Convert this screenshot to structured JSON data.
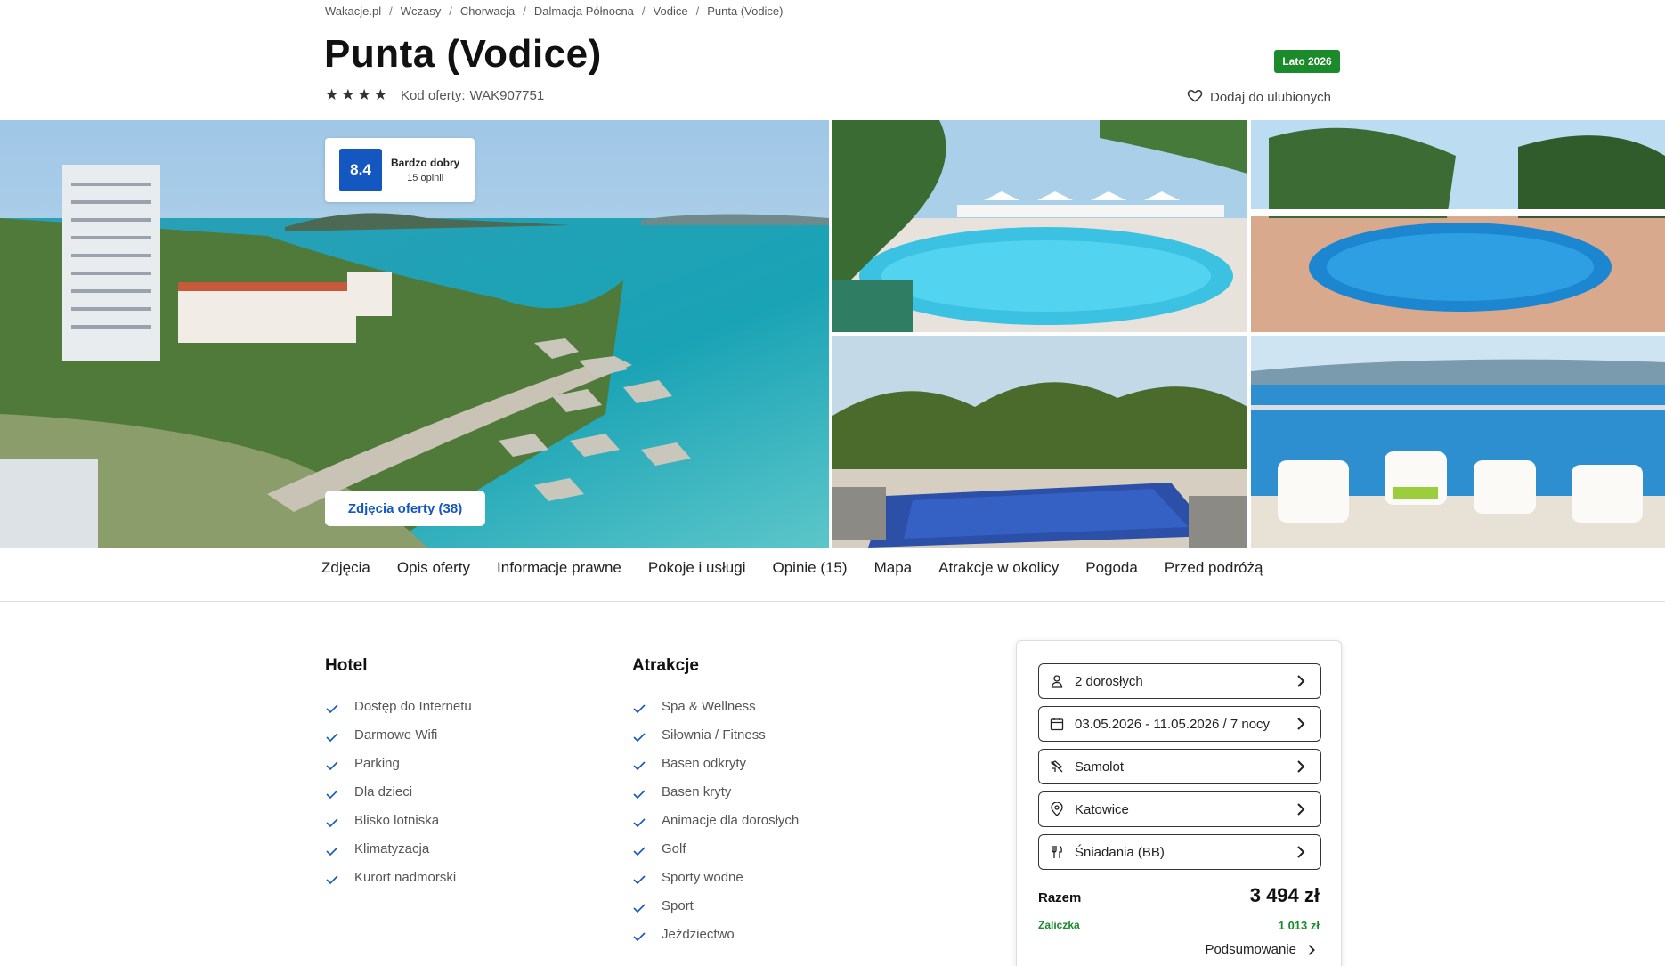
{
  "breadcrumb": [
    "Wakacje.pl",
    "Wczasy",
    "Chorwacja",
    "Dalmacja Północna",
    "Vodice",
    "Punta (Vodice)"
  ],
  "hotel": {
    "name": "Punta (Vodice)",
    "stars": 4,
    "offer_code_label": "Kod oferty:",
    "offer_code": "WAK907751",
    "season_badge": "Lato 2026",
    "favorite_label": "Dodaj do ulubionych"
  },
  "rating": {
    "score": "8.4",
    "label": "Bardzo dobry",
    "count": "15 opinii"
  },
  "gallery": {
    "photos_button": "Zdjęcia oferty (38)"
  },
  "tabs": [
    "Zdjęcia",
    "Opis oferty",
    "Informacje prawne",
    "Pokoje i usługi",
    "Opinie (15)",
    "Mapa",
    "Atrakcje w okolicy",
    "Pogoda",
    "Przed podróżą"
  ],
  "amenities": {
    "hotel_title": "Hotel",
    "hotel_items": [
      "Dostęp do Internetu",
      "Darmowe Wifi",
      "Parking",
      "Dla dzieci",
      "Blisko lotniska",
      "Klimatyzacja",
      "Kurort nadmorski"
    ],
    "attractions_title": "Atrakcje",
    "attractions_items": [
      "Spa & Wellness",
      "Siłownia / Fitness",
      "Basen odkryty",
      "Basen kryty",
      "Animacje dla dorosłych",
      "Golf",
      "Sporty wodne",
      "Sport",
      "Jeździectwo"
    ]
  },
  "booking": {
    "fields": [
      {
        "icon": "person-icon",
        "value": "2 dorosłych"
      },
      {
        "icon": "calendar-icon",
        "value": "03.05.2026 - 11.05.2026 / 7 nocy"
      },
      {
        "icon": "plane-icon",
        "value": "Samolot"
      },
      {
        "icon": "location-pin-icon",
        "value": "Katowice"
      },
      {
        "icon": "cutlery-icon",
        "value": "Śniadania (BB)"
      }
    ],
    "total_label": "Razem",
    "total_value": "3 494 zł",
    "deposit_label": "Zaliczka",
    "deposit_value": "1 013 zł",
    "summary_label": "Podsumowanie"
  },
  "colors": {
    "accent_blue": "#1557c0",
    "badge_green": "#1a8a2a"
  }
}
